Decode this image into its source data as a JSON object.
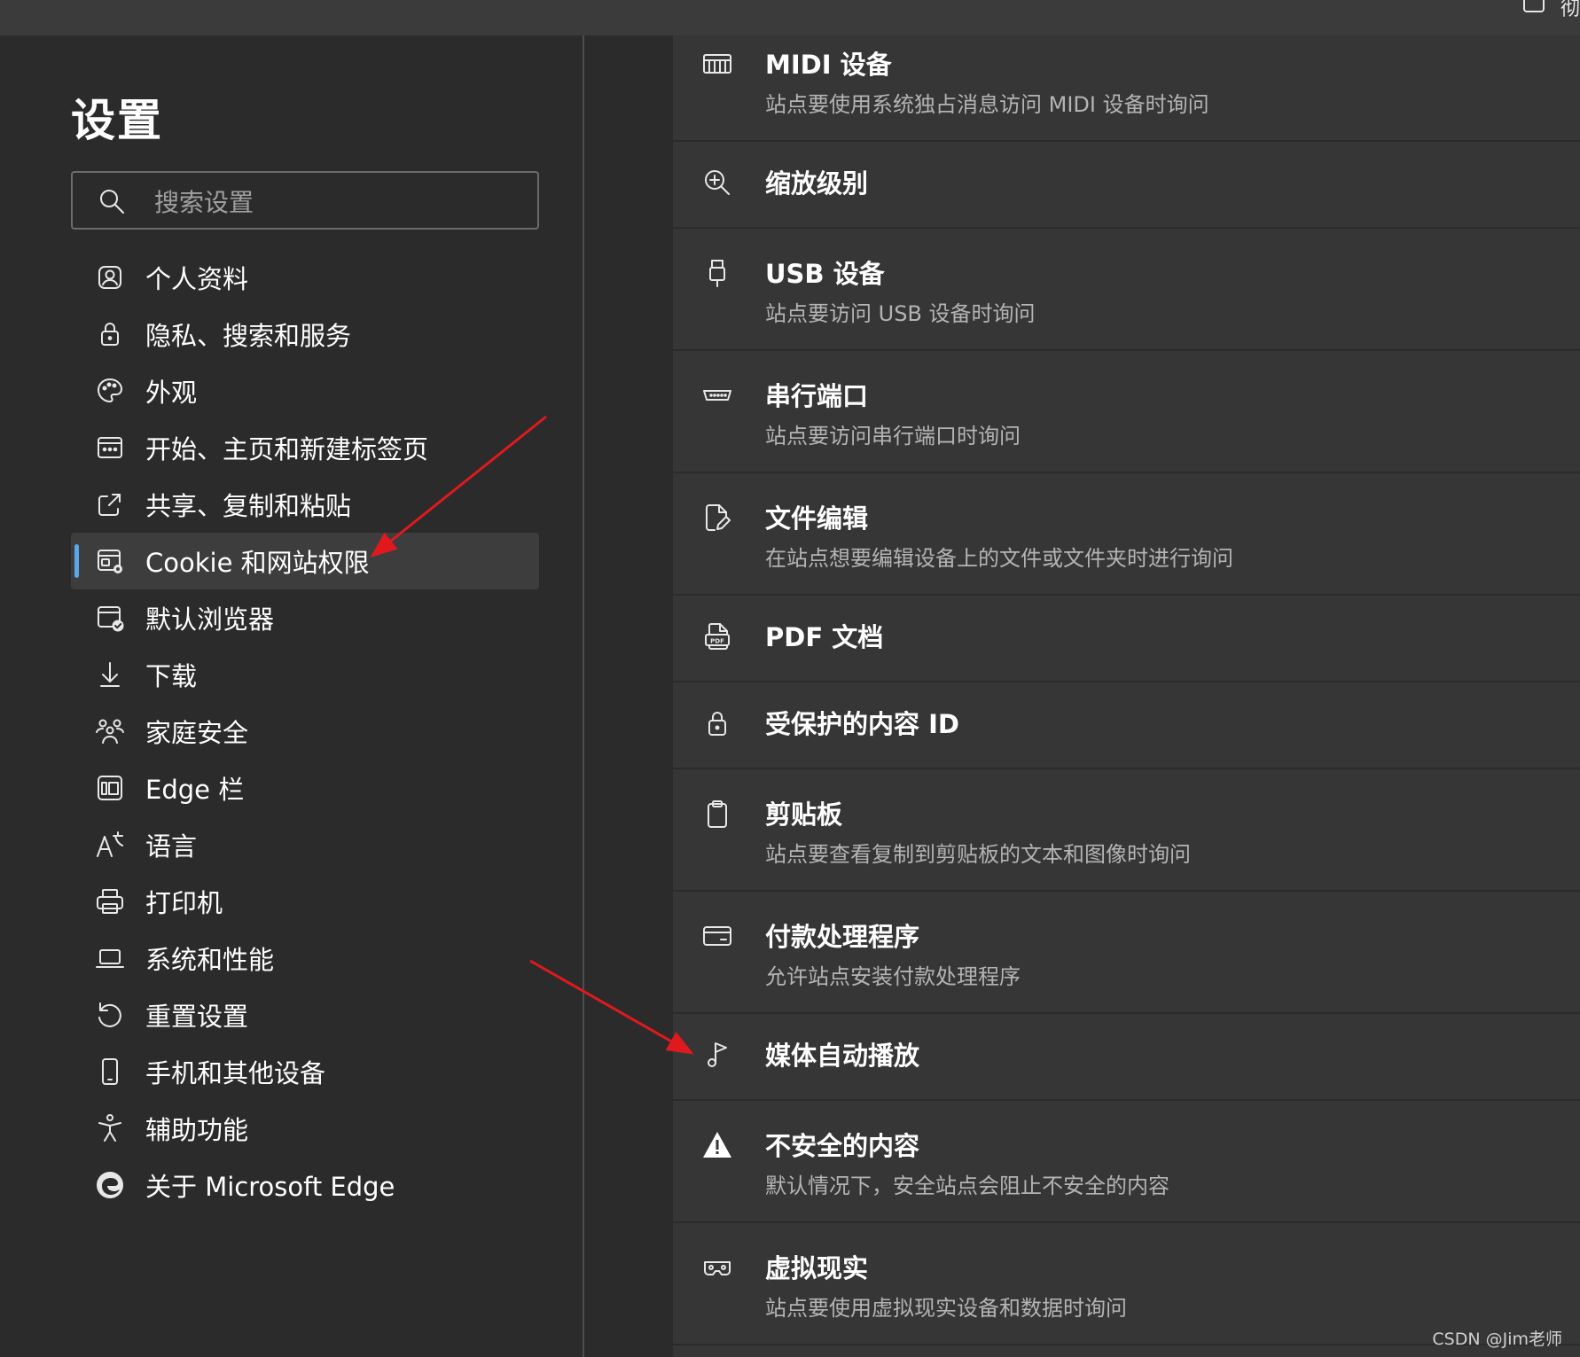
{
  "titlebar": {
    "clip_glyph": "彻"
  },
  "sidebar": {
    "title": "设置",
    "search": {
      "placeholder": "搜索设置",
      "value": ""
    },
    "items": [
      {
        "label": "个人资料",
        "icon": "profile-icon"
      },
      {
        "label": "隐私、搜索和服务",
        "icon": "lock-icon"
      },
      {
        "label": "外观",
        "icon": "palette-icon"
      },
      {
        "label": "开始、主页和新建标签页",
        "icon": "new-tab-icon"
      },
      {
        "label": "共享、复制和粘贴",
        "icon": "share-icon"
      },
      {
        "label": "Cookie 和网站权限",
        "icon": "cookie-site-icon",
        "active": true
      },
      {
        "label": "默认浏览器",
        "icon": "default-browser-icon"
      },
      {
        "label": "下载",
        "icon": "download-icon"
      },
      {
        "label": "家庭安全",
        "icon": "family-icon"
      },
      {
        "label": "Edge 栏",
        "icon": "edge-bar-icon"
      },
      {
        "label": "语言",
        "icon": "language-icon"
      },
      {
        "label": "打印机",
        "icon": "printer-icon"
      },
      {
        "label": "系统和性能",
        "icon": "laptop-icon"
      },
      {
        "label": "重置设置",
        "icon": "reset-icon"
      },
      {
        "label": "手机和其他设备",
        "icon": "phone-icon"
      },
      {
        "label": "辅助功能",
        "icon": "accessibility-icon"
      },
      {
        "label": "关于 Microsoft Edge",
        "icon": "edge-logo-icon"
      }
    ]
  },
  "permissions": [
    {
      "title": "MIDI 设备",
      "desc": "站点要使用系统独占消息访问 MIDI 设备时询问",
      "icon": "midi-icon"
    },
    {
      "title": "缩放级别",
      "desc": "",
      "icon": "zoom-icon"
    },
    {
      "title": "USB 设备",
      "desc": "站点要访问 USB 设备时询问",
      "icon": "usb-icon"
    },
    {
      "title": "串行端口",
      "desc": "站点要访问串行端口时询问",
      "icon": "serial-port-icon"
    },
    {
      "title": "文件编辑",
      "desc": "在站点想要编辑设备上的文件或文件夹时进行询问",
      "icon": "file-edit-icon"
    },
    {
      "title": "PDF 文档",
      "desc": "",
      "icon": "pdf-icon"
    },
    {
      "title": "受保护的内容 ID",
      "desc": "",
      "icon": "protected-lock-icon"
    },
    {
      "title": "剪贴板",
      "desc": "站点要查看复制到剪贴板的文本和图像时询问",
      "icon": "clipboard-icon"
    },
    {
      "title": "付款处理程序",
      "desc": "允许站点安装付款处理程序",
      "icon": "card-icon"
    },
    {
      "title": "媒体自动播放",
      "desc": "",
      "icon": "music-note-icon"
    },
    {
      "title": "不安全的内容",
      "desc": "默认情况下，安全站点会阻止不安全的内容",
      "icon": "warning-icon"
    },
    {
      "title": "虚拟现实",
      "desc": "站点要使用虚拟现实设备和数据时询问",
      "icon": "vr-headset-icon"
    }
  ],
  "watermark": "CSDN @Jim老师",
  "colors": {
    "accent": "#5aa7e8",
    "arrow": "#e0191e",
    "background": "#2b2b2b",
    "panel": "#363636"
  }
}
